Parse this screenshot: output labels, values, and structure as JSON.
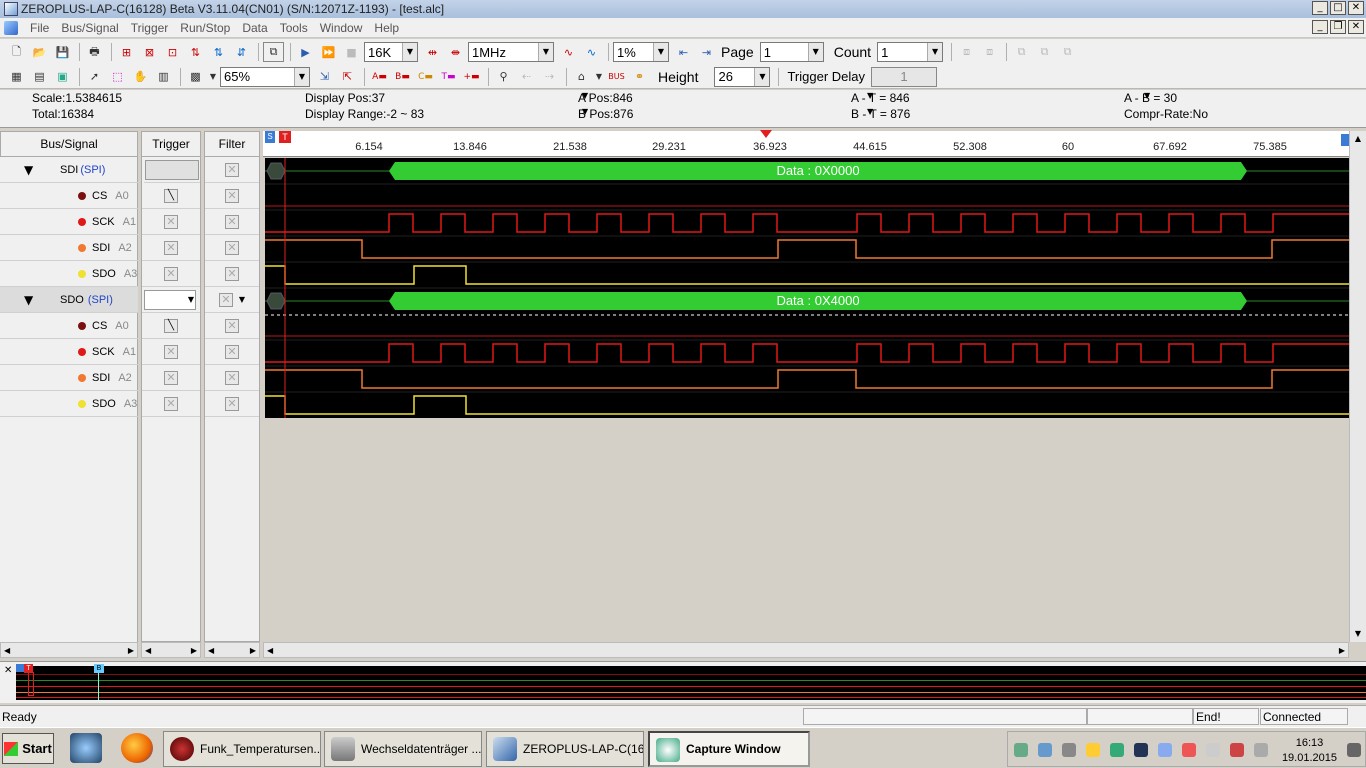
{
  "window": {
    "title": "ZEROPLUS-LAP-C(16128) Beta V3.11.04(CN01) (S/N:12071Z-1193) - [test.alc]"
  },
  "menu": [
    "File",
    "Bus/Signal",
    "Trigger",
    "Run/Stop",
    "Data",
    "Tools",
    "Window",
    "Help"
  ],
  "toolbar": {
    "memory_depth": "16K",
    "sample_rate": "1MHz",
    "trigger_position": "1%",
    "page_label": "Page",
    "page_value": "1",
    "count_label": "Count",
    "count_value": "1",
    "zoom": "65%",
    "height_label": "Height",
    "height_value": "26",
    "trigger_delay_label": "Trigger Delay",
    "trigger_delay_value": "1"
  },
  "info": {
    "scale": "Scale:1.5384615",
    "total": "Total:16384",
    "display_pos": "Display Pos:37",
    "display_range": "Display Range:-2 ~ 83",
    "a_pos": "A Pos:846",
    "b_pos": "B Pos:876",
    "a_minus_t": "A - T = 846",
    "b_minus_t": "B - T = 876",
    "a_minus_b": "A - B = 30",
    "compr_rate": "Compr-Rate:No"
  },
  "panels": {
    "signal_header": "Bus/Signal",
    "trigger_header": "Trigger",
    "filter_header": "Filter"
  },
  "buses": [
    {
      "name": "SDI",
      "protocol": "(SPI)",
      "decoded": "Data : 0X0000",
      "channels": [
        {
          "name": "CS",
          "pin": "A0",
          "color": "#7a1010"
        },
        {
          "name": "SCK",
          "pin": "A1",
          "color": "#e01818"
        },
        {
          "name": "SDI",
          "pin": "A2",
          "color": "#f07830"
        },
        {
          "name": "SDO",
          "pin": "A3",
          "color": "#f0e030"
        }
      ]
    },
    {
      "name": "SDO",
      "protocol": "(SPI)",
      "decoded": "Data : 0X4000",
      "channels": [
        {
          "name": "CS",
          "pin": "A0",
          "color": "#7a1010"
        },
        {
          "name": "SCK",
          "pin": "A1",
          "color": "#e01818"
        },
        {
          "name": "SDI",
          "pin": "A2",
          "color": "#f07830"
        },
        {
          "name": "SDO",
          "pin": "A3",
          "color": "#f0e030"
        }
      ]
    }
  ],
  "ruler_ticks": [
    "6.154",
    "13.846",
    "21.538",
    "29.231",
    "36.923",
    "44.615",
    "52.308",
    "60",
    "67.692",
    "75.385"
  ],
  "markers": {
    "trigger": "T",
    "a": "A",
    "b": "B"
  },
  "status": {
    "left": "Ready",
    "state": "End!",
    "connection": "Connected"
  },
  "taskbar": {
    "start": "Start",
    "tasks": [
      "Funk_Temperatursen...",
      "Wechseldatenträger ...",
      "ZEROPLUS-LAP-C(16...",
      "Capture Window"
    ],
    "time": "16:13",
    "date": "19.01.2015"
  },
  "colors": {
    "bus_green": "#33cc33",
    "cs": "#7a1010",
    "sck": "#e01818",
    "sdi": "#f07830",
    "sdo": "#f0e030"
  }
}
